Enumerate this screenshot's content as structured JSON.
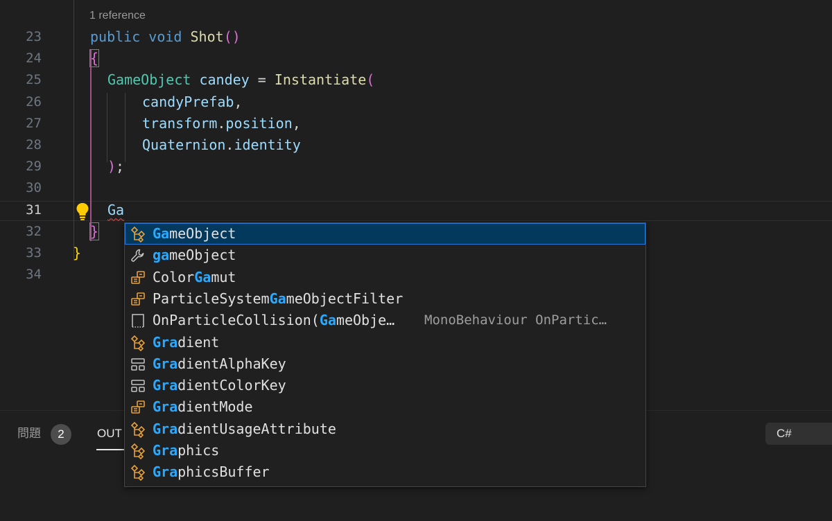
{
  "editor": {
    "codelens": "1 reference",
    "lines": [
      {
        "num": "23",
        "tokens": [
          [
            "kw",
            "public"
          ],
          [
            "pun",
            " "
          ],
          [
            "kw",
            "void"
          ],
          [
            "pun",
            " "
          ],
          [
            "fn",
            "Shot"
          ],
          [
            "brace-mag",
            "()"
          ]
        ]
      },
      {
        "num": "24",
        "tokens": [
          [
            "brace-mag brace-box",
            "{"
          ]
        ]
      },
      {
        "num": "25",
        "tokens": [
          [
            "ty",
            "GameObject"
          ],
          [
            "pun",
            " "
          ],
          [
            "id",
            "candey"
          ],
          [
            "pun",
            " = "
          ],
          [
            "fn",
            "Instantiate"
          ],
          [
            "brace-mag",
            "("
          ]
        ]
      },
      {
        "num": "26",
        "tokens": [
          [
            "id",
            "candyPrefab"
          ],
          [
            "pun",
            ","
          ]
        ]
      },
      {
        "num": "27",
        "tokens": [
          [
            "id",
            "transform"
          ],
          [
            "pun",
            "."
          ],
          [
            "id",
            "position"
          ],
          [
            "pun",
            ","
          ]
        ]
      },
      {
        "num": "28",
        "tokens": [
          [
            "id",
            "Quaternion"
          ],
          [
            "pun",
            "."
          ],
          [
            "id",
            "identity"
          ]
        ]
      },
      {
        "num": "29",
        "tokens": [
          [
            "brace-mag",
            ")"
          ],
          [
            "pun",
            ";"
          ]
        ]
      },
      {
        "num": "30",
        "tokens": []
      },
      {
        "num": "31",
        "tokens": [
          [
            "id squiggle",
            "Ga"
          ]
        ]
      },
      {
        "num": "32",
        "tokens": [
          [
            "brace-mag brace-box",
            "}"
          ]
        ]
      },
      {
        "num": "33",
        "tokens": [
          [
            "brace-yel",
            "}"
          ]
        ]
      },
      {
        "num": "34",
        "tokens": []
      }
    ]
  },
  "suggestions": [
    {
      "icon": "class-icon",
      "match": "Ga",
      "rest": "meObject",
      "pre": "",
      "detail": "",
      "selected": true
    },
    {
      "icon": "property-icon",
      "match": "ga",
      "rest": "meObject",
      "pre": "",
      "detail": ""
    },
    {
      "icon": "enum-icon",
      "pre": "Color",
      "match": "Ga",
      "rest": "mut",
      "detail": ""
    },
    {
      "icon": "enum-icon",
      "pre": "ParticleSystem",
      "match": "Ga",
      "rest": "meObjectFilter",
      "detail": ""
    },
    {
      "icon": "snippet-icon",
      "pre": "OnParticleCollision(",
      "match": "Ga",
      "rest": "meObje…",
      "detail": "MonoBehaviour OnPartic…"
    },
    {
      "icon": "class-icon",
      "pre": "",
      "match": "Gra",
      "rest": "dient",
      "detail": ""
    },
    {
      "icon": "struct-icon",
      "pre": "",
      "match": "Gra",
      "rest": "dientAlphaKey",
      "detail": ""
    },
    {
      "icon": "struct-icon",
      "pre": "",
      "match": "Gra",
      "rest": "dientColorKey",
      "detail": ""
    },
    {
      "icon": "enum-icon",
      "pre": "",
      "match": "Gra",
      "rest": "dientMode",
      "detail": ""
    },
    {
      "icon": "class-icon",
      "pre": "",
      "match": "Gra",
      "rest": "dientUsageAttribute",
      "detail": ""
    },
    {
      "icon": "class-icon",
      "pre": "",
      "match": "Gra",
      "rest": "phics",
      "detail": ""
    },
    {
      "icon": "class-icon",
      "pre": "",
      "match": "Gra",
      "rest": "phicsBuffer",
      "detail": ""
    }
  ],
  "panel": {
    "problems_label": "問題",
    "problems_count": "2",
    "output_label": "OUT",
    "language": "C#"
  },
  "colors": {
    "class_icon": "#e8a13a",
    "struct_icon": "#c5c5c5",
    "highlight": "#2aaaff"
  }
}
